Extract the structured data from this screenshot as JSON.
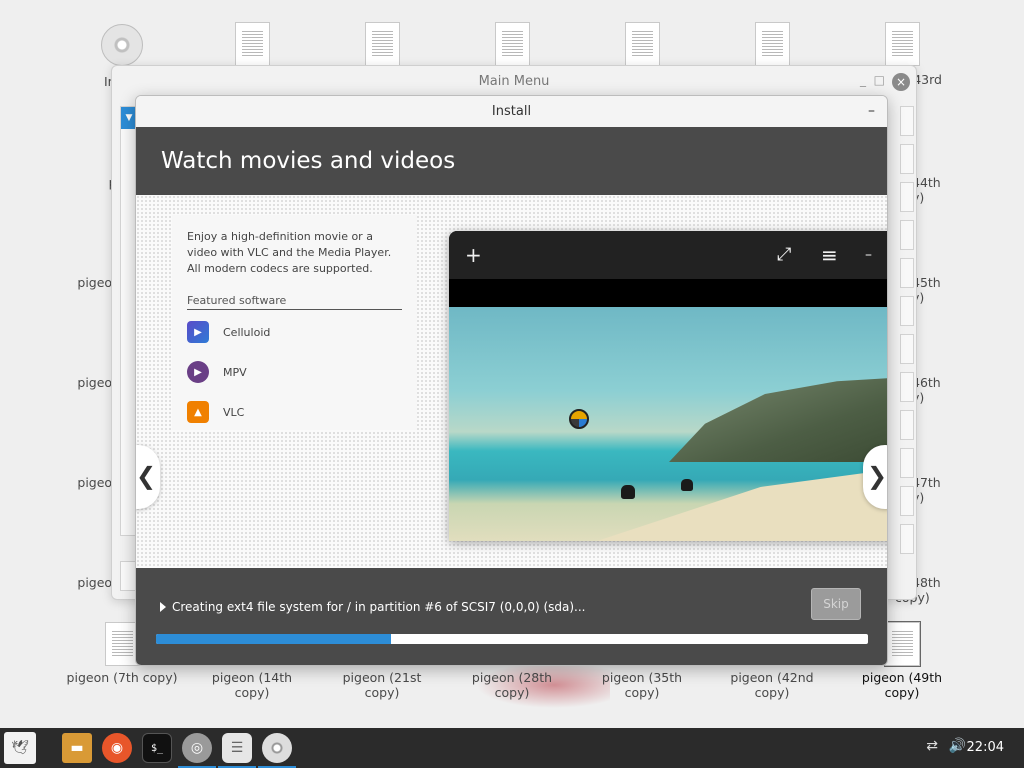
{
  "desktop": {
    "icons_top": [
      {
        "label": "In",
        "type": "disc"
      },
      {
        "label": "",
        "type": "doc"
      },
      {
        "label": "",
        "type": "doc"
      },
      {
        "label": "",
        "type": "doc"
      },
      {
        "label": "",
        "type": "doc"
      },
      {
        "label": "",
        "type": "doc"
      },
      {
        "label": "43rd",
        "type": "doc"
      }
    ],
    "left_column_labels": [
      "pi",
      "pigeon",
      "pigeon",
      "pigeon",
      "pigeon"
    ],
    "right_column_labels": [
      "44th",
      "45th",
      "46th",
      "47th",
      "48th"
    ],
    "right_column_suffix": "y)",
    "right_column_last_suffix": "copy)",
    "bottom_row": [
      {
        "line1": "pigeon (7th copy)",
        "line2": ""
      },
      {
        "line1": "pigeon (14th",
        "line2": "copy)"
      },
      {
        "line1": "pigeon (21st",
        "line2": "copy)"
      },
      {
        "line1": "pigeon (28th",
        "line2": "copy)"
      },
      {
        "line1": "pigeon (35th",
        "line2": "copy)"
      },
      {
        "line1": "pigeon (42nd",
        "line2": "copy)"
      },
      {
        "line1": "pigeon (49th",
        "line2": "copy)"
      }
    ]
  },
  "main_menu": {
    "title": "Main Menu",
    "minimize": "_",
    "maximize": "□",
    "close": "×"
  },
  "install": {
    "window_title": "Install",
    "minimize": "–",
    "heading": "Watch movies and videos",
    "description": "Enjoy a high-definition movie or a video with VLC and the Media Player. All modern codecs are supported.",
    "featured_title": "Featured software",
    "apps": [
      {
        "name": "Celluloid",
        "icon": "celluloid-icon"
      },
      {
        "name": "MPV",
        "icon": "mpv-icon"
      },
      {
        "name": "VLC",
        "icon": "vlc-icon"
      }
    ],
    "player": {
      "add_button": "+",
      "fullscreen_button": "⤢",
      "menu_button": "≡",
      "minimize_button": "–"
    },
    "prev": "❮",
    "next": "❯",
    "status": "Creating ext4 file system for / in partition #6 of SCSI7 (0,0,0) (sda)...",
    "skip_label": "Skip",
    "progress": 0.33
  },
  "taskbar": {
    "clock": "22:04",
    "tray_network": "⇄",
    "tray_volume": "🔊",
    "terminal_glyph": "$_"
  },
  "colors": {
    "accent": "#2d8dd7",
    "header_bg": "#4a4a4a",
    "taskbar_bg": "#2b2b2b"
  }
}
